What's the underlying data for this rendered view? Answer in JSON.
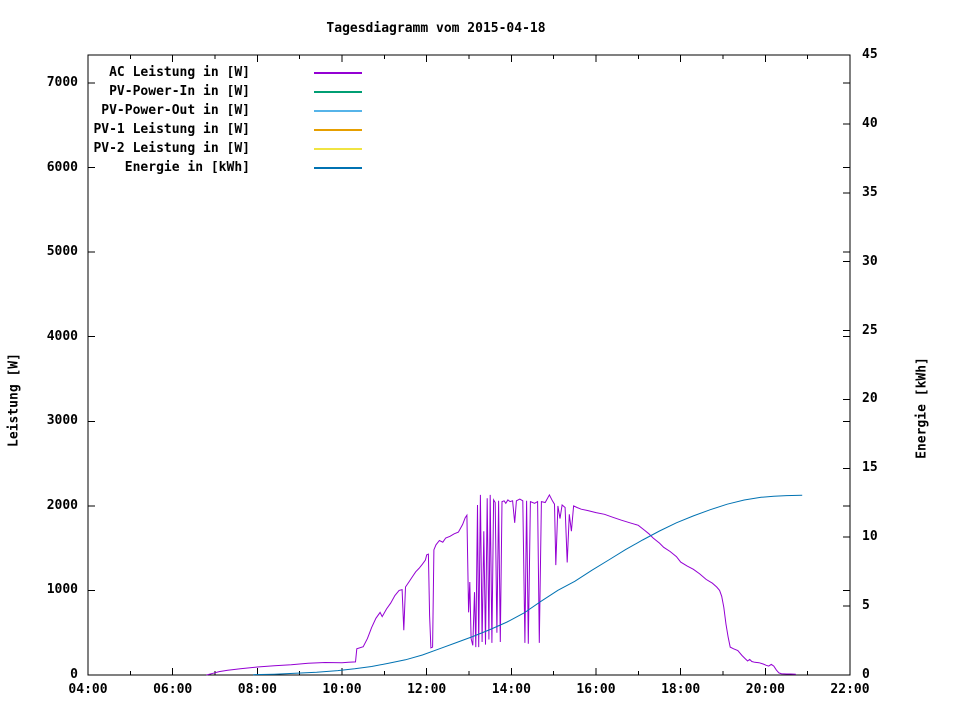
{
  "title": "Tagesdiagramm vom 2015-04-18",
  "chart_data": {
    "type": "line",
    "title": "Tagesdiagramm vom 2015-04-18",
    "grid": false,
    "legend_position": "top-left-inside",
    "x_axis": {
      "range_hours": [
        4,
        22
      ],
      "tick_hours": [
        4,
        6,
        8,
        10,
        12,
        14,
        16,
        18,
        20,
        22
      ],
      "tick_labels": [
        "04:00",
        "06:00",
        "08:00",
        "10:00",
        "12:00",
        "14:00",
        "16:00",
        "18:00",
        "20:00",
        "22:00"
      ],
      "minor_tick_hours": [
        5,
        7,
        9,
        11,
        13,
        15,
        17,
        19,
        21
      ]
    },
    "y_axis_left": {
      "label": "Leistung [W]",
      "ticks": [
        0,
        1000,
        2000,
        3000,
        4000,
        5000,
        6000,
        7000
      ],
      "range": [
        0,
        7331
      ]
    },
    "y_axis_right": {
      "label": "Energie [kWh]",
      "ticks": [
        0,
        5,
        10,
        15,
        20,
        25,
        30,
        35,
        40,
        45
      ],
      "range": [
        0,
        45
      ]
    },
    "legend": [
      {
        "label": "AC Leistung in [W]",
        "color": "#9400d3"
      },
      {
        "label": "PV-Power-In in [W]",
        "color": "#009e73"
      },
      {
        "label": "PV-Power-Out in [W]",
        "color": "#56b4e9"
      },
      {
        "label": "PV-1 Leistung in [W]",
        "color": "#e69f00"
      },
      {
        "label": "PV-2 Leistung in [W]",
        "color": "#f0e442"
      },
      {
        "label": "Energie in [kWh]",
        "color": "#0072b2"
      }
    ],
    "series": [
      {
        "name": "AC Leistung in [W]",
        "color": "#9400d3",
        "axis": "left",
        "points": [
          [
            6.8,
            0
          ],
          [
            6.95,
            20
          ],
          [
            7.1,
            40
          ],
          [
            7.3,
            55
          ],
          [
            7.6,
            75
          ],
          [
            8.0,
            95
          ],
          [
            8.4,
            110
          ],
          [
            8.8,
            122
          ],
          [
            9.2,
            138
          ],
          [
            9.6,
            148
          ],
          [
            10.0,
            145
          ],
          [
            10.15,
            150
          ],
          [
            10.32,
            155
          ],
          [
            10.35,
            310
          ],
          [
            10.5,
            335
          ],
          [
            10.6,
            430
          ],
          [
            10.7,
            560
          ],
          [
            10.8,
            670
          ],
          [
            10.9,
            740
          ],
          [
            10.95,
            690
          ],
          [
            11.05,
            780
          ],
          [
            11.15,
            850
          ],
          [
            11.25,
            940
          ],
          [
            11.35,
            1000
          ],
          [
            11.42,
            1010
          ],
          [
            11.46,
            530
          ],
          [
            11.5,
            1040
          ],
          [
            11.58,
            1100
          ],
          [
            11.66,
            1160
          ],
          [
            11.74,
            1220
          ],
          [
            11.82,
            1260
          ],
          [
            11.9,
            1310
          ],
          [
            11.97,
            1360
          ],
          [
            12.0,
            1420
          ],
          [
            12.04,
            1430
          ],
          [
            12.07,
            700
          ],
          [
            12.1,
            320
          ],
          [
            12.14,
            330
          ],
          [
            12.17,
            1480
          ],
          [
            12.22,
            1540
          ],
          [
            12.3,
            1590
          ],
          [
            12.38,
            1570
          ],
          [
            12.45,
            1620
          ],
          [
            12.55,
            1640
          ],
          [
            12.65,
            1670
          ],
          [
            12.75,
            1690
          ],
          [
            12.85,
            1780
          ],
          [
            12.91,
            1860
          ],
          [
            12.95,
            1890
          ],
          [
            12.99,
            740
          ],
          [
            13.02,
            1100
          ],
          [
            13.05,
            430
          ],
          [
            13.09,
            350
          ],
          [
            13.13,
            980
          ],
          [
            13.16,
            330
          ],
          [
            13.2,
            2010
          ],
          [
            13.23,
            330
          ],
          [
            13.27,
            2130
          ],
          [
            13.31,
            390
          ],
          [
            13.35,
            1700
          ],
          [
            13.39,
            360
          ],
          [
            13.43,
            2090
          ],
          [
            13.47,
            420
          ],
          [
            13.5,
            2130
          ],
          [
            13.54,
            380
          ],
          [
            13.58,
            2070
          ],
          [
            13.62,
            2040
          ],
          [
            13.66,
            500
          ],
          [
            13.7,
            2060
          ],
          [
            13.74,
            390
          ],
          [
            13.78,
            2050
          ],
          [
            13.83,
            2060
          ],
          [
            13.87,
            2030
          ],
          [
            13.92,
            2070
          ],
          [
            13.97,
            2050
          ],
          [
            14.03,
            2060
          ],
          [
            14.08,
            1800
          ],
          [
            14.12,
            2060
          ],
          [
            14.2,
            2080
          ],
          [
            14.27,
            2060
          ],
          [
            14.32,
            380
          ],
          [
            14.36,
            2060
          ],
          [
            14.4,
            370
          ],
          [
            14.45,
            2050
          ],
          [
            14.55,
            2030
          ],
          [
            14.62,
            2050
          ],
          [
            14.66,
            380
          ],
          [
            14.71,
            2050
          ],
          [
            14.8,
            2040
          ],
          [
            14.9,
            2130
          ],
          [
            14.97,
            2060
          ],
          [
            15.02,
            2020
          ],
          [
            15.05,
            1300
          ],
          [
            15.1,
            2000
          ],
          [
            15.15,
            1850
          ],
          [
            15.2,
            2010
          ],
          [
            15.27,
            1980
          ],
          [
            15.32,
            1330
          ],
          [
            15.37,
            1900
          ],
          [
            15.42,
            1700
          ],
          [
            15.47,
            2000
          ],
          [
            15.55,
            1980
          ],
          [
            15.65,
            1960
          ],
          [
            15.8,
            1945
          ],
          [
            16.0,
            1920
          ],
          [
            16.2,
            1900
          ],
          [
            16.4,
            1865
          ],
          [
            16.6,
            1830
          ],
          [
            16.8,
            1800
          ],
          [
            17.0,
            1770
          ],
          [
            17.15,
            1710
          ],
          [
            17.25,
            1670
          ],
          [
            17.35,
            1620
          ],
          [
            17.5,
            1560
          ],
          [
            17.6,
            1510
          ],
          [
            17.75,
            1460
          ],
          [
            17.9,
            1400
          ],
          [
            18.0,
            1335
          ],
          [
            18.15,
            1290
          ],
          [
            18.3,
            1250
          ],
          [
            18.45,
            1195
          ],
          [
            18.6,
            1130
          ],
          [
            18.75,
            1085
          ],
          [
            18.85,
            1040
          ],
          [
            18.92,
            1000
          ],
          [
            18.97,
            930
          ],
          [
            19.02,
            800
          ],
          [
            19.07,
            600
          ],
          [
            19.12,
            450
          ],
          [
            19.17,
            330
          ],
          [
            19.25,
            310
          ],
          [
            19.35,
            290
          ],
          [
            19.45,
            230
          ],
          [
            19.52,
            195
          ],
          [
            19.58,
            165
          ],
          [
            19.63,
            185
          ],
          [
            19.68,
            160
          ],
          [
            19.75,
            150
          ],
          [
            19.85,
            145
          ],
          [
            19.95,
            130
          ],
          [
            20.02,
            115
          ],
          [
            20.08,
            105
          ],
          [
            20.14,
            125
          ],
          [
            20.2,
            105
          ],
          [
            20.26,
            60
          ],
          [
            20.32,
            25
          ],
          [
            20.38,
            15
          ],
          [
            20.5,
            12
          ],
          [
            20.6,
            12
          ],
          [
            20.72,
            10
          ]
        ]
      },
      {
        "name": "PV-Power-In in [W]",
        "color": "#009e73",
        "axis": "left",
        "points": []
      },
      {
        "name": "PV-Power-Out in [W]",
        "color": "#56b4e9",
        "axis": "left",
        "points": []
      },
      {
        "name": "PV-1 Leistung in [W]",
        "color": "#e69f00",
        "axis": "left",
        "points": []
      },
      {
        "name": "PV-2 Leistung in [W]",
        "color": "#f0e442",
        "axis": "left",
        "points": []
      },
      {
        "name": "Energie in [kWh]",
        "color": "#0072b2",
        "axis": "right",
        "points": [
          [
            7.9,
            0.02
          ],
          [
            8.4,
            0.06
          ],
          [
            8.9,
            0.12
          ],
          [
            9.4,
            0.2
          ],
          [
            9.9,
            0.32
          ],
          [
            10.3,
            0.45
          ],
          [
            10.7,
            0.62
          ],
          [
            11.1,
            0.85
          ],
          [
            11.5,
            1.1
          ],
          [
            11.9,
            1.45
          ],
          [
            12.3,
            1.9
          ],
          [
            12.7,
            2.35
          ],
          [
            13.1,
            2.8
          ],
          [
            13.5,
            3.3
          ],
          [
            13.9,
            3.85
          ],
          [
            14.3,
            4.5
          ],
          [
            14.7,
            5.35
          ],
          [
            15.1,
            6.15
          ],
          [
            15.5,
            6.8
          ],
          [
            15.9,
            7.6
          ],
          [
            16.3,
            8.35
          ],
          [
            16.7,
            9.1
          ],
          [
            17.1,
            9.8
          ],
          [
            17.5,
            10.45
          ],
          [
            17.9,
            11.05
          ],
          [
            18.3,
            11.55
          ],
          [
            18.7,
            12.0
          ],
          [
            19.1,
            12.4
          ],
          [
            19.5,
            12.7
          ],
          [
            19.9,
            12.9
          ],
          [
            20.2,
            12.98
          ],
          [
            20.5,
            13.02
          ],
          [
            20.87,
            13.05
          ]
        ]
      }
    ]
  }
}
